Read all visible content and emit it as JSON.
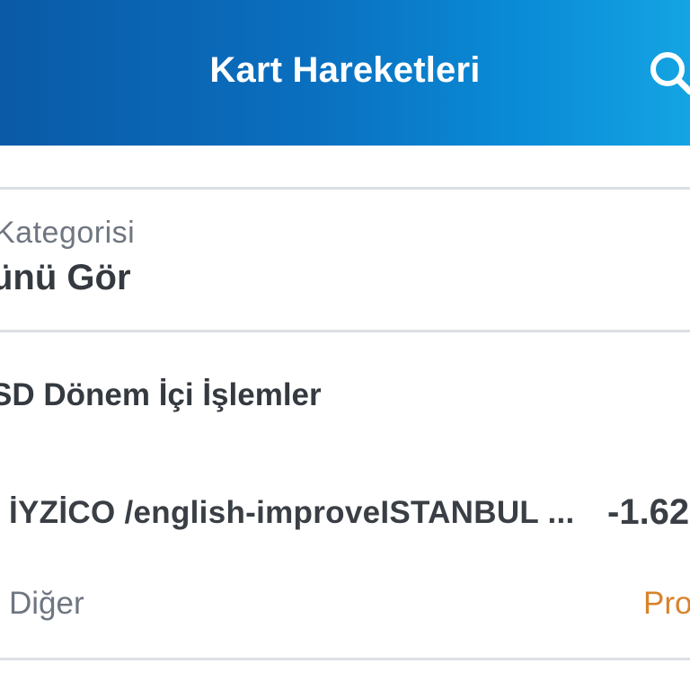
{
  "header": {
    "title": "Kart Hareketleri",
    "search_icon": "search-icon",
    "gradient_colors": [
      "#0a5aa6",
      "#14a4e3"
    ]
  },
  "category_filter": {
    "label": "Kategorisi",
    "value": "ünü Gör"
  },
  "section": {
    "title": "SD Dönem İçi İşlemler"
  },
  "transaction": {
    "merchant": "İYZİCO /english-improveISTANBUL ...",
    "amount": "-1.62",
    "category": "Diğer",
    "status": "Pro",
    "status_color": "#d9822b"
  }
}
